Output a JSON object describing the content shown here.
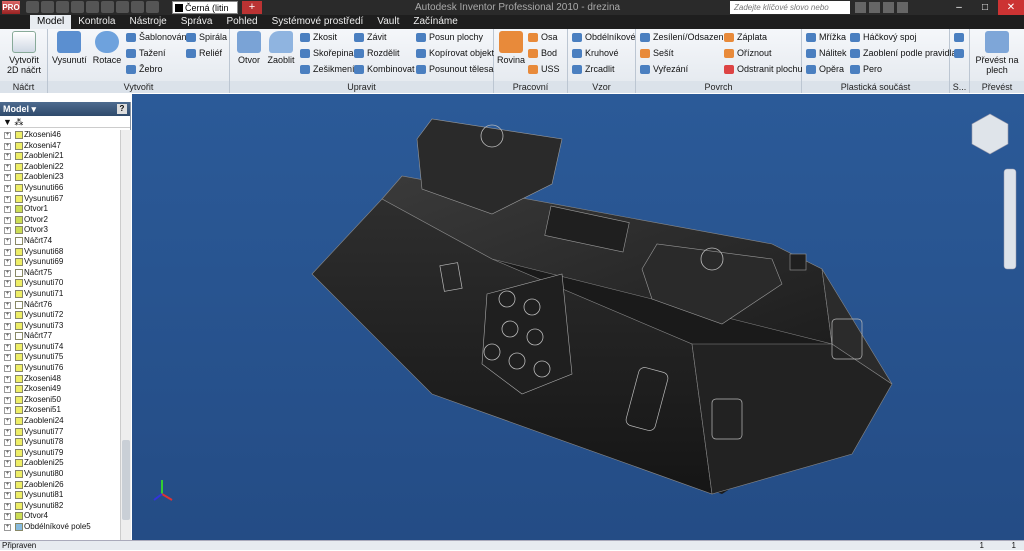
{
  "app": {
    "title": "Autodesk Inventor Professional 2010 - drezina",
    "material": "Černá (litin",
    "search_placeholder": "Zadejte klíčové slovo nebo výraz."
  },
  "tabs": [
    "Model",
    "Kontrola",
    "Nástroje",
    "Správa",
    "Pohled",
    "Systémové prostředí",
    "Vault",
    "Začínáme"
  ],
  "ribbon": {
    "nacrt": {
      "create_2d": "Vytvořit 2D náčrt",
      "title": "Náčrt"
    },
    "vytvorit": {
      "title": "Vytvořit",
      "vysunuti": "Vysunutí",
      "rotace": "Rotace",
      "sablonovani": "Šablonování",
      "tazeni": "Tažení",
      "zebro": "Žebro",
      "spirala": "Spirála",
      "relief": "Reliéf"
    },
    "upravit": {
      "title": "Upravit",
      "otvor": "Otvor",
      "zaoblit": "Zaoblit",
      "zkosit": "Zkosit",
      "skorepina": "Skořepina",
      "zeslimeni": "Zešikmení",
      "zavit": "Závit",
      "rozdelit": "Rozdělit",
      "kombinovat": "Kombinovat",
      "posun_plochy": "Posun plochy",
      "kopirovat_objekt": "Kopírovat objekt",
      "posunout_telesa": "Posunout tělesa"
    },
    "prac": {
      "title": "Pracovní konstruk...",
      "rovina": "Rovina",
      "osa": "Osa",
      "bod": "Bod",
      "uss": "USS"
    },
    "vzor": {
      "title": "Vzor",
      "obdelnikove": "Obdélníkové",
      "kruhove": "Kruhové",
      "zrcadlit": "Zrcadlit"
    },
    "povrch": {
      "title": "Povrch",
      "zesileni": "Zesílení/Odsazení",
      "sesit": "Sešít",
      "vyrezani": "Vyřezání",
      "zaplata": "Záplata",
      "oriznout": "Oříznout",
      "odstranit": "Odstranit plochu"
    },
    "plast": {
      "title": "Plastická součást",
      "mrizka": "Mřížka",
      "nalitek": "Nálitek",
      "opera": "Opěra",
      "hackovy": "Háčkový spoj",
      "zaobleni": "Zaoblení podle pravidla",
      "pero": "Pero"
    },
    "s": {
      "title": "S..."
    },
    "prevest": {
      "title": "Převést",
      "label": "Převést na plech"
    }
  },
  "browser": {
    "header": "Model ▾",
    "help": "?",
    "filter": "▼ ⁂",
    "items": [
      "Zkoseni46",
      "Zkoseni47",
      "Zaobleni21",
      "Zaobleni22",
      "Zaobleni23",
      "Vysunuti66",
      "Vysunuti67",
      "Otvor1",
      "Otvor2",
      "Otvor3",
      "Náčrt74",
      "Vysunuti68",
      "Vysunuti69",
      "Náčrt75",
      "Vysunuti70",
      "Vysunuti71",
      "Náčrt76",
      "Vysunuti72",
      "Vysunuti73",
      "Náčrt77",
      "Vysunuti74",
      "Vysunuti75",
      "Vysunuti76",
      "Zkoseni48",
      "Zkoseni49",
      "Zkoseni50",
      "Zkoseni51",
      "Zaobleni24",
      "Vysunuti77",
      "Vysunuti78",
      "Vysunuti79",
      "Zaobleni25",
      "Vysunuti80",
      "Zaobleni26",
      "Vysunuti81",
      "Vysunuti82",
      "Otvor4",
      "Obdélníkové pole5"
    ]
  },
  "status": {
    "text": "Připraven",
    "n1": "1",
    "n2": "1"
  },
  "colors": {
    "viewport": "#2b5a98",
    "tab_bar": "#1e1e1e",
    "ribbon": "#e3e8ee"
  }
}
